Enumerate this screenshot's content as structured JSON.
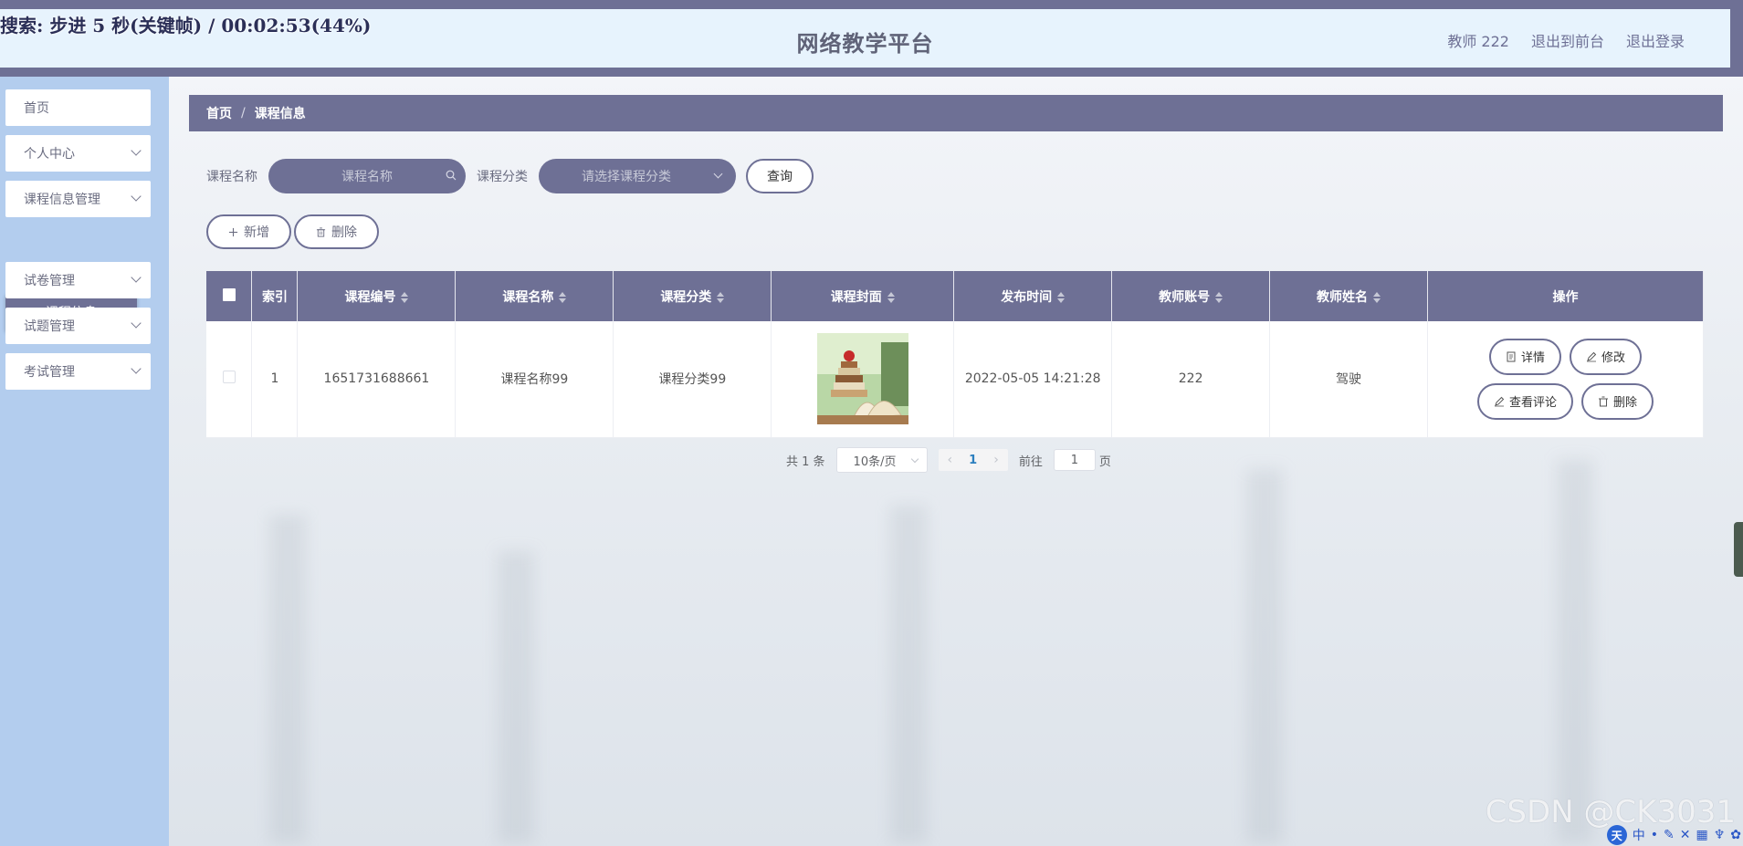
{
  "overlay": {
    "recording_caption": "搜索: 步进 5 秒(关键帧) / 00:02:53(44%)"
  },
  "header": {
    "title": "网络教学平台",
    "user": "教师 222",
    "back_to_front": "退出到前台",
    "logout": "退出登录"
  },
  "sidebar": {
    "items": [
      {
        "label": "首页"
      },
      {
        "label": "个人中心"
      },
      {
        "label": "课程信息管理"
      },
      {
        "label": "试卷管理"
      },
      {
        "label": "试题管理"
      },
      {
        "label": "考试管理"
      }
    ],
    "active_sub": "课程信息"
  },
  "breadcrumb": {
    "home": "首页",
    "separator": "/",
    "current": "课程信息"
  },
  "search": {
    "name_label": "课程名称",
    "name_placeholder": "课程名称",
    "category_label": "课程分类",
    "category_placeholder": "请选择课程分类",
    "query_button": "查询"
  },
  "actions": {
    "add": "新增",
    "delete": "删除"
  },
  "table": {
    "headers": [
      "索引",
      "课程编号",
      "课程名称",
      "课程分类",
      "课程封面",
      "发布时间",
      "教师账号",
      "教师姓名",
      "操作"
    ],
    "rows": [
      {
        "index": "1",
        "course_code": "1651731688661",
        "course_name": "课程名称99",
        "category": "课程分类99",
        "publish_time": "2022-05-05 14:21:28",
        "teacher_account": "222",
        "teacher_name": "驾驶",
        "ops": {
          "detail": "详情",
          "edit": "修改",
          "comments": "查看评论",
          "delete": "删除"
        }
      }
    ]
  },
  "pagination": {
    "total": "共 1 条",
    "page_size": "10条/页",
    "current_page": "1",
    "goto_label": "前往",
    "goto_value": "1",
    "page_suffix": "页"
  },
  "watermark": "CSDN @CK3031",
  "tray": {
    "ime": "中"
  },
  "colors": {
    "accent": "#6e7095",
    "header_bg": "#e7f3fd",
    "sidebar_bg": "#b3cdee"
  }
}
